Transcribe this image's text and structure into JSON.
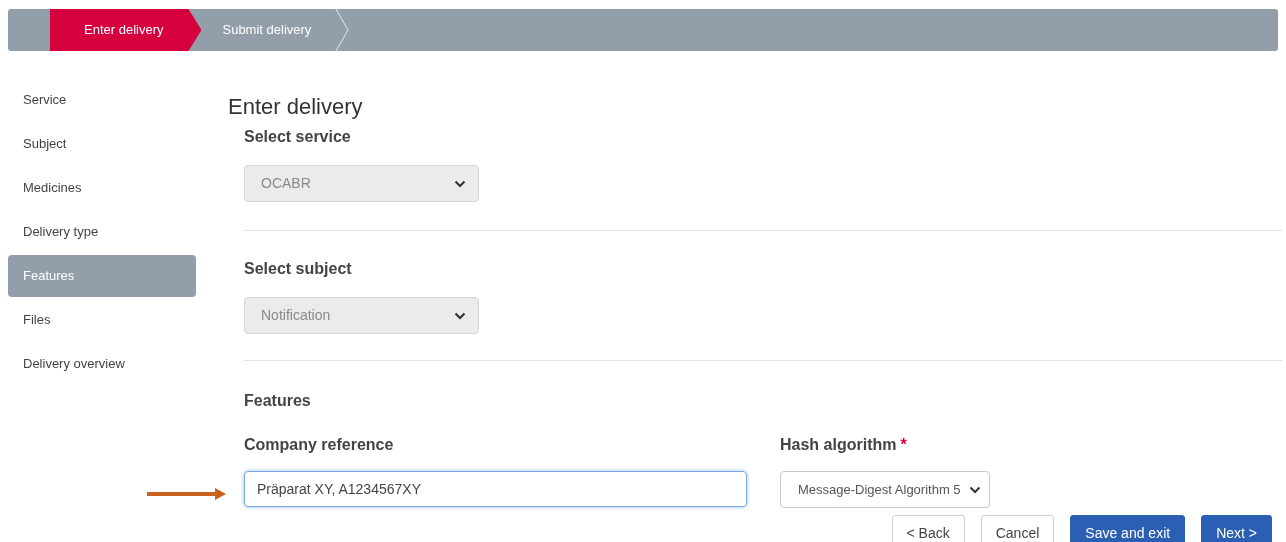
{
  "steps": [
    {
      "label": "Enter delivery",
      "selected": true
    },
    {
      "label": "Submit delivery",
      "selected": false
    }
  ],
  "sidebar": {
    "items": [
      {
        "label": "Service",
        "selected": false
      },
      {
        "label": "Subject",
        "selected": false
      },
      {
        "label": "Medicines",
        "selected": false
      },
      {
        "label": "Delivery type",
        "selected": false
      },
      {
        "label": "Features",
        "selected": true
      },
      {
        "label": "Files",
        "selected": false
      },
      {
        "label": "Delivery overview",
        "selected": false
      }
    ]
  },
  "main": {
    "title": "Enter delivery",
    "sections": [
      {
        "heading": "Select service",
        "select": {
          "value": "OCABR",
          "disabled": true
        }
      },
      {
        "heading": "Select subject",
        "select": {
          "value": "Notification",
          "disabled": true
        }
      }
    ],
    "features": {
      "heading": "Features",
      "company_reference": {
        "label": "Company reference",
        "value": "Präparat XY, A1234567XY",
        "focused": true
      },
      "hash_algorithm": {
        "label": "Hash algorithm",
        "required_mark": "*",
        "value": "Message-Digest Algorithm 5",
        "disabled": false
      }
    },
    "buttons": [
      {
        "label": "< Back",
        "kind": "secondary"
      },
      {
        "label": "Cancel",
        "kind": "secondary"
      },
      {
        "label": "Save and exit",
        "kind": "primary"
      },
      {
        "label": "Next >",
        "kind": "primary"
      }
    ]
  }
}
